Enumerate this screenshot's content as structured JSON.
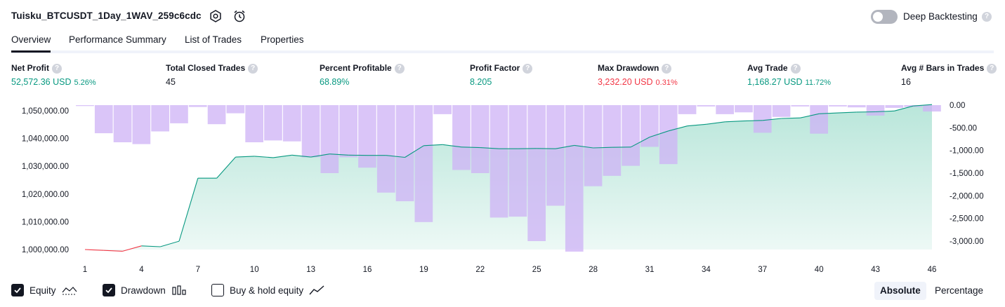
{
  "header": {
    "strategy_name": "Tuisku_BTCUSDT_1Day_1WAV_259c6cdc",
    "deep_backtesting_label": "Deep Backtesting",
    "deep_backtesting_on": false,
    "help_glyph": "?"
  },
  "tabs": [
    {
      "label": "Overview",
      "active": true
    },
    {
      "label": "Performance Summary",
      "active": false
    },
    {
      "label": "List of Trades",
      "active": false
    },
    {
      "label": "Properties",
      "active": false
    }
  ],
  "metrics": [
    {
      "label": "Net Profit",
      "value": "52,572.36 USD",
      "pct": "5.26%",
      "color": "#089981"
    },
    {
      "label": "Total Closed Trades",
      "value": "45",
      "pct": "",
      "color": "#131722"
    },
    {
      "label": "Percent Profitable",
      "value": "68.89%",
      "pct": "",
      "color": "#089981"
    },
    {
      "label": "Profit Factor",
      "value": "8.205",
      "pct": "",
      "color": "#089981"
    },
    {
      "label": "Max Drawdown",
      "value": "3,232.20 USD",
      "pct": "0.31%",
      "color": "#f23645"
    },
    {
      "label": "Avg Trade",
      "value": "1,168.27 USD",
      "pct": "11.72%",
      "color": "#089981"
    },
    {
      "label": "Avg # Bars in Trades",
      "value": "16",
      "pct": "",
      "color": "#131722"
    }
  ],
  "chart_data": {
    "type": "area",
    "x_ticks": [
      "1",
      "4",
      "7",
      "10",
      "13",
      "16",
      "19",
      "22",
      "25",
      "28",
      "31",
      "34",
      "37",
      "40",
      "43",
      "46"
    ],
    "x_range": [
      1,
      46
    ],
    "equity": {
      "ylim": [
        1000000,
        1052000
      ],
      "y_ticks": [
        "1,000,000.00",
        "1,010,000.00",
        "1,020,000.00",
        "1,030,000.00",
        "1,040,000.00",
        "1,050,000.00"
      ],
      "y_tick_values": [
        1000000,
        1010000,
        1020000,
        1030000,
        1040000,
        1050000
      ],
      "x": [
        1,
        2,
        3,
        4,
        5,
        6,
        7,
        8,
        9,
        10,
        11,
        12,
        13,
        14,
        15,
        16,
        17,
        18,
        19,
        20,
        21,
        22,
        23,
        24,
        25,
        26,
        27,
        28,
        29,
        30,
        31,
        32,
        33,
        34,
        35,
        36,
        37,
        38,
        39,
        40,
        41,
        42,
        43,
        44,
        45,
        46
      ],
      "values": [
        1000000,
        999700,
        999400,
        1001300,
        1001000,
        1003000,
        1025700,
        1025700,
        1033300,
        1033600,
        1033100,
        1034000,
        1033300,
        1034400,
        1034000,
        1033900,
        1033900,
        1033200,
        1037400,
        1037800,
        1036900,
        1036700,
        1036300,
        1036300,
        1036400,
        1036300,
        1037500,
        1036600,
        1036800,
        1036900,
        1040500,
        1042700,
        1044500,
        1045100,
        1046000,
        1046300,
        1046500,
        1047200,
        1047400,
        1048900,
        1049200,
        1049500,
        1049600,
        1049900,
        1051700,
        1052200
      ],
      "series_color_up": "#089981",
      "series_color_down": "#f23645",
      "area_color": "#b9e6da"
    },
    "drawdown": {
      "ylim": [
        -3232.2,
        0
      ],
      "y_ticks": [
        "0.00",
        "-500.00",
        "-1,000.00",
        "-1,500.00",
        "-2,000.00",
        "-2,500.00",
        "-3,000.00"
      ],
      "y_tick_values": [
        0,
        -500,
        -1000,
        -1500,
        -2000,
        -2500,
        -3000
      ],
      "values": [
        -20,
        -620,
        -820,
        -860,
        -580,
        -400,
        -40,
        -420,
        -180,
        -820,
        -780,
        -800,
        -1150,
        -1500,
        -1150,
        -1380,
        -1930,
        -2120,
        -2580,
        -200,
        -1430,
        -1500,
        -2480,
        -2460,
        -3000,
        -2220,
        -3232,
        -1790,
        -1560,
        -1340,
        -920,
        -1300,
        -200,
        -30,
        -200,
        -160,
        -610,
        -260,
        -30,
        -630,
        -30,
        -50,
        -230,
        -60,
        -40,
        -140
      ],
      "bar_color": "#cdb2f5"
    },
    "grid": false
  },
  "legend": {
    "items": [
      {
        "label": "Equity",
        "checked": true,
        "glyph": "equity-icon"
      },
      {
        "label": "Drawdown",
        "checked": true,
        "glyph": "drawdown-bars-icon"
      },
      {
        "label": "Buy & hold equity",
        "checked": false,
        "glyph": "buy-hold-line-icon"
      }
    ],
    "modes": [
      {
        "label": "Absolute",
        "active": true
      },
      {
        "label": "Percentage",
        "active": false
      }
    ]
  }
}
